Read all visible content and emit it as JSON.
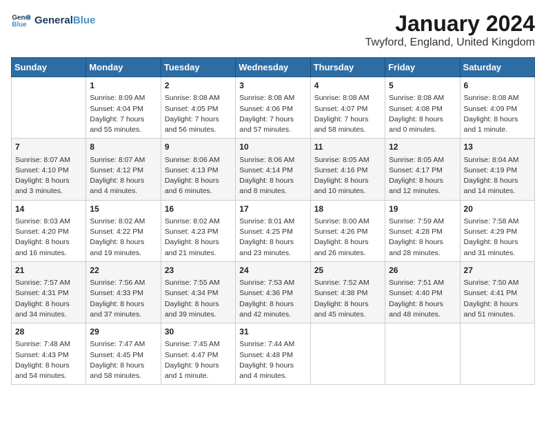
{
  "header": {
    "logo_line1": "General",
    "logo_line2": "Blue",
    "title": "January 2024",
    "subtitle": "Twyford, England, United Kingdom"
  },
  "days_of_week": [
    "Sunday",
    "Monday",
    "Tuesday",
    "Wednesday",
    "Thursday",
    "Friday",
    "Saturday"
  ],
  "weeks": [
    [
      {
        "day": "",
        "info": ""
      },
      {
        "day": "1",
        "info": "Sunrise: 8:09 AM\nSunset: 4:04 PM\nDaylight: 7 hours\nand 55 minutes."
      },
      {
        "day": "2",
        "info": "Sunrise: 8:08 AM\nSunset: 4:05 PM\nDaylight: 7 hours\nand 56 minutes."
      },
      {
        "day": "3",
        "info": "Sunrise: 8:08 AM\nSunset: 4:06 PM\nDaylight: 7 hours\nand 57 minutes."
      },
      {
        "day": "4",
        "info": "Sunrise: 8:08 AM\nSunset: 4:07 PM\nDaylight: 7 hours\nand 58 minutes."
      },
      {
        "day": "5",
        "info": "Sunrise: 8:08 AM\nSunset: 4:08 PM\nDaylight: 8 hours\nand 0 minutes."
      },
      {
        "day": "6",
        "info": "Sunrise: 8:08 AM\nSunset: 4:09 PM\nDaylight: 8 hours\nand 1 minute."
      }
    ],
    [
      {
        "day": "7",
        "info": "Sunrise: 8:07 AM\nSunset: 4:10 PM\nDaylight: 8 hours\nand 3 minutes."
      },
      {
        "day": "8",
        "info": "Sunrise: 8:07 AM\nSunset: 4:12 PM\nDaylight: 8 hours\nand 4 minutes."
      },
      {
        "day": "9",
        "info": "Sunrise: 8:06 AM\nSunset: 4:13 PM\nDaylight: 8 hours\nand 6 minutes."
      },
      {
        "day": "10",
        "info": "Sunrise: 8:06 AM\nSunset: 4:14 PM\nDaylight: 8 hours\nand 8 minutes."
      },
      {
        "day": "11",
        "info": "Sunrise: 8:05 AM\nSunset: 4:16 PM\nDaylight: 8 hours\nand 10 minutes."
      },
      {
        "day": "12",
        "info": "Sunrise: 8:05 AM\nSunset: 4:17 PM\nDaylight: 8 hours\nand 12 minutes."
      },
      {
        "day": "13",
        "info": "Sunrise: 8:04 AM\nSunset: 4:19 PM\nDaylight: 8 hours\nand 14 minutes."
      }
    ],
    [
      {
        "day": "14",
        "info": "Sunrise: 8:03 AM\nSunset: 4:20 PM\nDaylight: 8 hours\nand 16 minutes."
      },
      {
        "day": "15",
        "info": "Sunrise: 8:02 AM\nSunset: 4:22 PM\nDaylight: 8 hours\nand 19 minutes."
      },
      {
        "day": "16",
        "info": "Sunrise: 8:02 AM\nSunset: 4:23 PM\nDaylight: 8 hours\nand 21 minutes."
      },
      {
        "day": "17",
        "info": "Sunrise: 8:01 AM\nSunset: 4:25 PM\nDaylight: 8 hours\nand 23 minutes."
      },
      {
        "day": "18",
        "info": "Sunrise: 8:00 AM\nSunset: 4:26 PM\nDaylight: 8 hours\nand 26 minutes."
      },
      {
        "day": "19",
        "info": "Sunrise: 7:59 AM\nSunset: 4:28 PM\nDaylight: 8 hours\nand 28 minutes."
      },
      {
        "day": "20",
        "info": "Sunrise: 7:58 AM\nSunset: 4:29 PM\nDaylight: 8 hours\nand 31 minutes."
      }
    ],
    [
      {
        "day": "21",
        "info": "Sunrise: 7:57 AM\nSunset: 4:31 PM\nDaylight: 8 hours\nand 34 minutes."
      },
      {
        "day": "22",
        "info": "Sunrise: 7:56 AM\nSunset: 4:33 PM\nDaylight: 8 hours\nand 37 minutes."
      },
      {
        "day": "23",
        "info": "Sunrise: 7:55 AM\nSunset: 4:34 PM\nDaylight: 8 hours\nand 39 minutes."
      },
      {
        "day": "24",
        "info": "Sunrise: 7:53 AM\nSunset: 4:36 PM\nDaylight: 8 hours\nand 42 minutes."
      },
      {
        "day": "25",
        "info": "Sunrise: 7:52 AM\nSunset: 4:38 PM\nDaylight: 8 hours\nand 45 minutes."
      },
      {
        "day": "26",
        "info": "Sunrise: 7:51 AM\nSunset: 4:40 PM\nDaylight: 8 hours\nand 48 minutes."
      },
      {
        "day": "27",
        "info": "Sunrise: 7:50 AM\nSunset: 4:41 PM\nDaylight: 8 hours\nand 51 minutes."
      }
    ],
    [
      {
        "day": "28",
        "info": "Sunrise: 7:48 AM\nSunset: 4:43 PM\nDaylight: 8 hours\nand 54 minutes."
      },
      {
        "day": "29",
        "info": "Sunrise: 7:47 AM\nSunset: 4:45 PM\nDaylight: 8 hours\nand 58 minutes."
      },
      {
        "day": "30",
        "info": "Sunrise: 7:45 AM\nSunset: 4:47 PM\nDaylight: 9 hours\nand 1 minute."
      },
      {
        "day": "31",
        "info": "Sunrise: 7:44 AM\nSunset: 4:48 PM\nDaylight: 9 hours\nand 4 minutes."
      },
      {
        "day": "",
        "info": ""
      },
      {
        "day": "",
        "info": ""
      },
      {
        "day": "",
        "info": ""
      }
    ]
  ]
}
